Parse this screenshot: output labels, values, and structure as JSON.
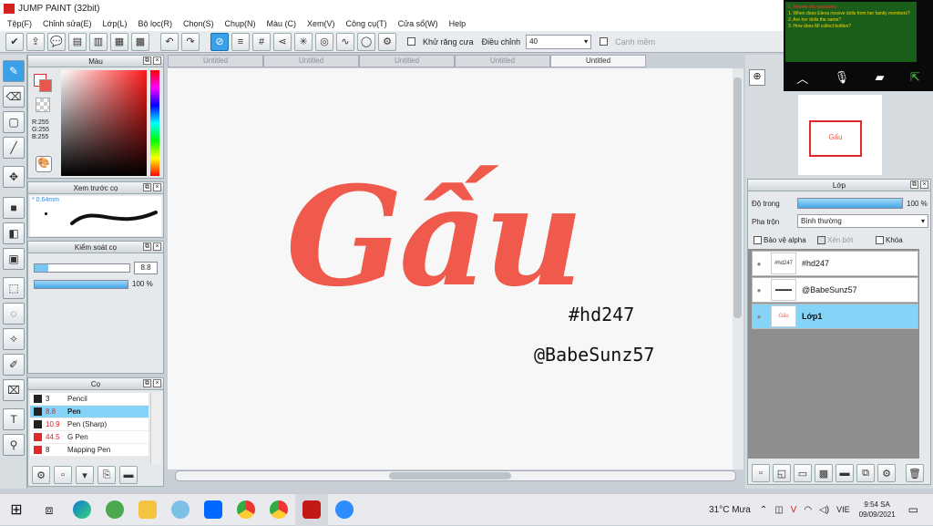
{
  "window": {
    "title": "JUMP PAINT (32bit)"
  },
  "menu": [
    "Tệp(F)",
    "Chỉnh sửa(E)",
    "Lớp(L)",
    "Bộ lọc(R)",
    "Chọn(S)",
    "Chụp(N)",
    "Màu (C)",
    "Xem(V)",
    "Công cụ(T)",
    "Cửa sổ(W)",
    "Help"
  ],
  "toolbar": {
    "antialias_label": "Khử răng cưa",
    "adjust_label": "Điều chỉnh",
    "adjust_value": "40",
    "edge_label": "Cạnh mềm"
  },
  "color_panel": {
    "title": "Màu",
    "r": "R:255",
    "g": "G:255",
    "b": "B:255",
    "main_color": "#e9564b"
  },
  "preview_panel": {
    "title": "Xem trước cọ",
    "size": "0.64mm"
  },
  "control_panel": {
    "title": "Kiểm soát cọ",
    "size_value": "8.8",
    "opacity_value": "100 %"
  },
  "brush_panel": {
    "title": "Cọ",
    "brushes": [
      {
        "size": "3",
        "name": "Pencil",
        "color": "#222222"
      },
      {
        "size": "8.8",
        "name": "Pen",
        "color": "#222222"
      },
      {
        "size": "10.9",
        "name": "Pen (Sharp)",
        "color": "#222222"
      },
      {
        "size": "44.5",
        "name": "G Pen",
        "color": "#e02a2a"
      },
      {
        "size": "8",
        "name": "Mapping Pen",
        "color": "#e02a2a"
      }
    ]
  },
  "tabs": [
    "Untitled",
    "Untitled",
    "Untitled",
    "Untitled",
    "Untitled"
  ],
  "canvas": {
    "word": "Gấu",
    "tag1": "#hd247",
    "tag2": "@BabeSunz57",
    "word_color": "#ef5a4c"
  },
  "layers_panel": {
    "title": "Lớp",
    "opacity_label": "Độ trong",
    "opacity_value": "100 %",
    "blend_label": "Pha trộn",
    "blend_value": "Bình thường",
    "protect_alpha": "Bảo vệ alpha",
    "clip": "Xén bớt",
    "lock": "Khóa",
    "layers": [
      {
        "name": "#hd247",
        "thumb": "#hd247"
      },
      {
        "name": "@BabeSunz57",
        "thumb": "▬▬▬"
      },
      {
        "name": "Lớp1",
        "thumb": "Gấu"
      }
    ]
  },
  "video_overlay": {
    "lines": [
      "0. Answer the questions.",
      "1. When does Elena receive dolls from her family members?",
      "2. Are her dolls the same?",
      "3. How does Mi collect bottles?"
    ]
  },
  "taskbar": {
    "weather": "31°C Mưa",
    "lang": "VIE",
    "time": "9:54 SA",
    "date": "09/09/2021"
  }
}
